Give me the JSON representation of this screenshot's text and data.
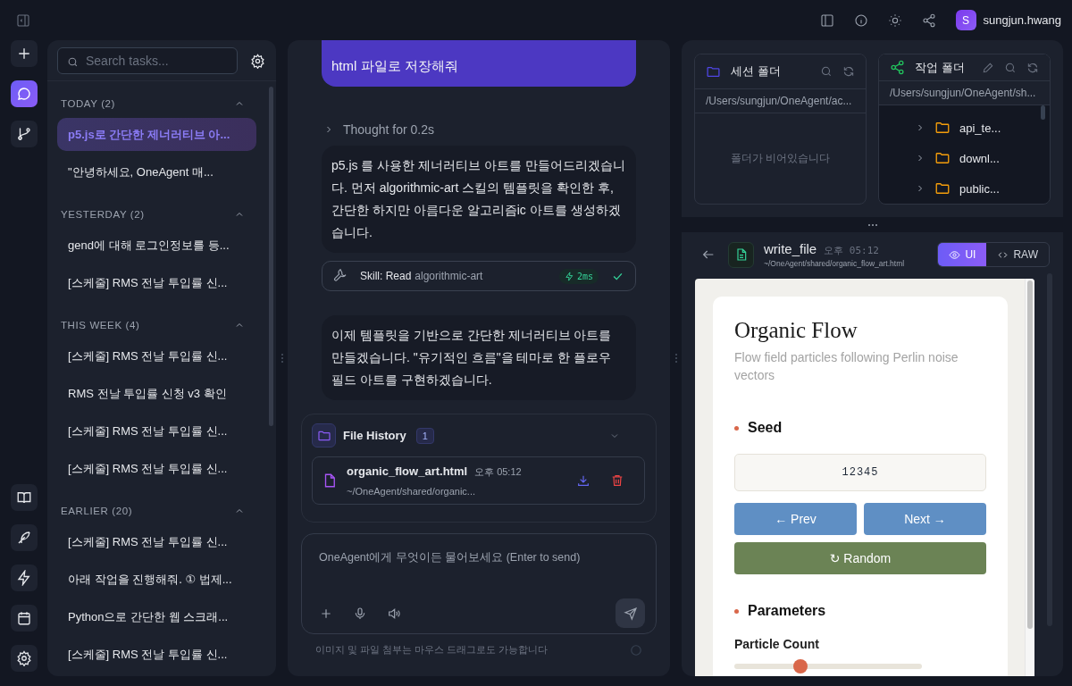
{
  "topbar": {
    "user": {
      "initial": "S",
      "name": "sungjun.hwang"
    }
  },
  "rail": [
    {
      "kind": "new",
      "selected": false
    },
    {
      "kind": "chat",
      "selected": true
    },
    {
      "kind": "branch",
      "selected": false
    }
  ],
  "tasks": {
    "search": {
      "placeholder": "Search tasks..."
    },
    "groups": [
      {
        "title": "TODAY (2)",
        "expanded": true,
        "items": [
          {
            "label": "p5.js로 간단한 제너러티브 아...",
            "selected": true
          },
          {
            "label": "\"안녕하세요, OneAgent 매...",
            "selected": false
          }
        ]
      },
      {
        "title": "YESTERDAY (2)",
        "expanded": true,
        "items": [
          {
            "label": "gend에 대해 로그인정보를 등...",
            "selected": false
          },
          {
            "label": "[스케줄] RMS 전날 투입률 신...",
            "selected": false
          }
        ]
      },
      {
        "title": "THIS WEEK (4)",
        "expanded": true,
        "items": [
          {
            "label": "[스케줄] RMS 전날 투입률 신...",
            "selected": false
          },
          {
            "label": "RMS 전날 투입률 신청 v3 확인",
            "selected": false
          },
          {
            "label": "[스케줄] RMS 전날 투입률 신...",
            "selected": false
          },
          {
            "label": "[스케줄] RMS 전날 투입률 신...",
            "selected": false
          }
        ]
      },
      {
        "title": "EARLIER (20)",
        "expanded": true,
        "items": [
          {
            "label": "[스케줄] RMS 전날 투입률 신...",
            "selected": false
          },
          {
            "label": "아래 작업을 진행해줘. ① 법제...",
            "selected": false
          },
          {
            "label": "Python으로 간단한 웹 스크래...",
            "selected": false
          },
          {
            "label": "[스케줄] RMS 전날 투입률 신...",
            "selected": false
          }
        ]
      }
    ]
  },
  "chat": {
    "messages": [
      {
        "kind": "user",
        "text": "html 파일로 저장해줘"
      },
      {
        "kind": "thought",
        "text": "Thought for 0.2s"
      },
      {
        "kind": "assistant",
        "text": "p5.js 를 사용한 제너러티브 아트를 만들어드리겠습니다. 먼저 algorithmic-art 스킬의 템플릿을 확인한 후, 간단한 하지만 아름다운 알고리즘ic 아트를 생성하겠습니다."
      },
      {
        "kind": "tool",
        "label": "Skill: Read",
        "target": "algorithmic-art",
        "duration": "2ms",
        "done": true
      },
      {
        "kind": "assistant",
        "text": "이제 템플릿을 기반으로 간단한 제너러티브 아트를 만들겠습니다. \"유기적인 흐름\"을 테마로 한 플로우 필드 아트를 구현하겠습니다."
      }
    ],
    "file_history": {
      "title": "File History",
      "count": "1",
      "expanded": false,
      "files": [
        {
          "name": "organic_flow_art.html",
          "time": "오후 05:12",
          "path": "~/OneAgent/shared/organic..."
        }
      ]
    },
    "composer": {
      "placeholder": "OneAgent에게 무엇이든 물어보세요 (Enter to send)",
      "hint": "이미지 및 파일 첨부는 마우스 드래그로도 가능합니다"
    }
  },
  "folders": {
    "session": {
      "title": "세션 폴더",
      "path": "/Users/sungjun/OneAgent/ac...",
      "empty_text": "폴더가 비어있습니다"
    },
    "work": {
      "title": "작업 폴더",
      "path": "/Users/sungjun/OneAgent/sh...",
      "items": [
        {
          "name": "api_te...",
          "expanded": false
        },
        {
          "name": "downl...",
          "expanded": false
        },
        {
          "name": "public...",
          "expanded": false
        }
      ]
    }
  },
  "viewer": {
    "tool": "write_file",
    "time": "오후 05:12",
    "path": "~/OneAgent/shared/organic_flow_art.html",
    "modes": [
      {
        "kind": "ui",
        "label": "UI",
        "selected": true
      },
      {
        "kind": "raw",
        "label": "RAW",
        "selected": false
      }
    ],
    "preview": {
      "title": "Organic Flow",
      "subtitle": "Flow field particles following Perlin noise vectors",
      "seed_heading": "Seed",
      "seed_value": "12345",
      "prev": "← Prev",
      "next": "Next →",
      "random": "↻ Random",
      "params_heading": "Parameters",
      "param": {
        "label": "Particle Count",
        "level": 0.35
      }
    }
  }
}
